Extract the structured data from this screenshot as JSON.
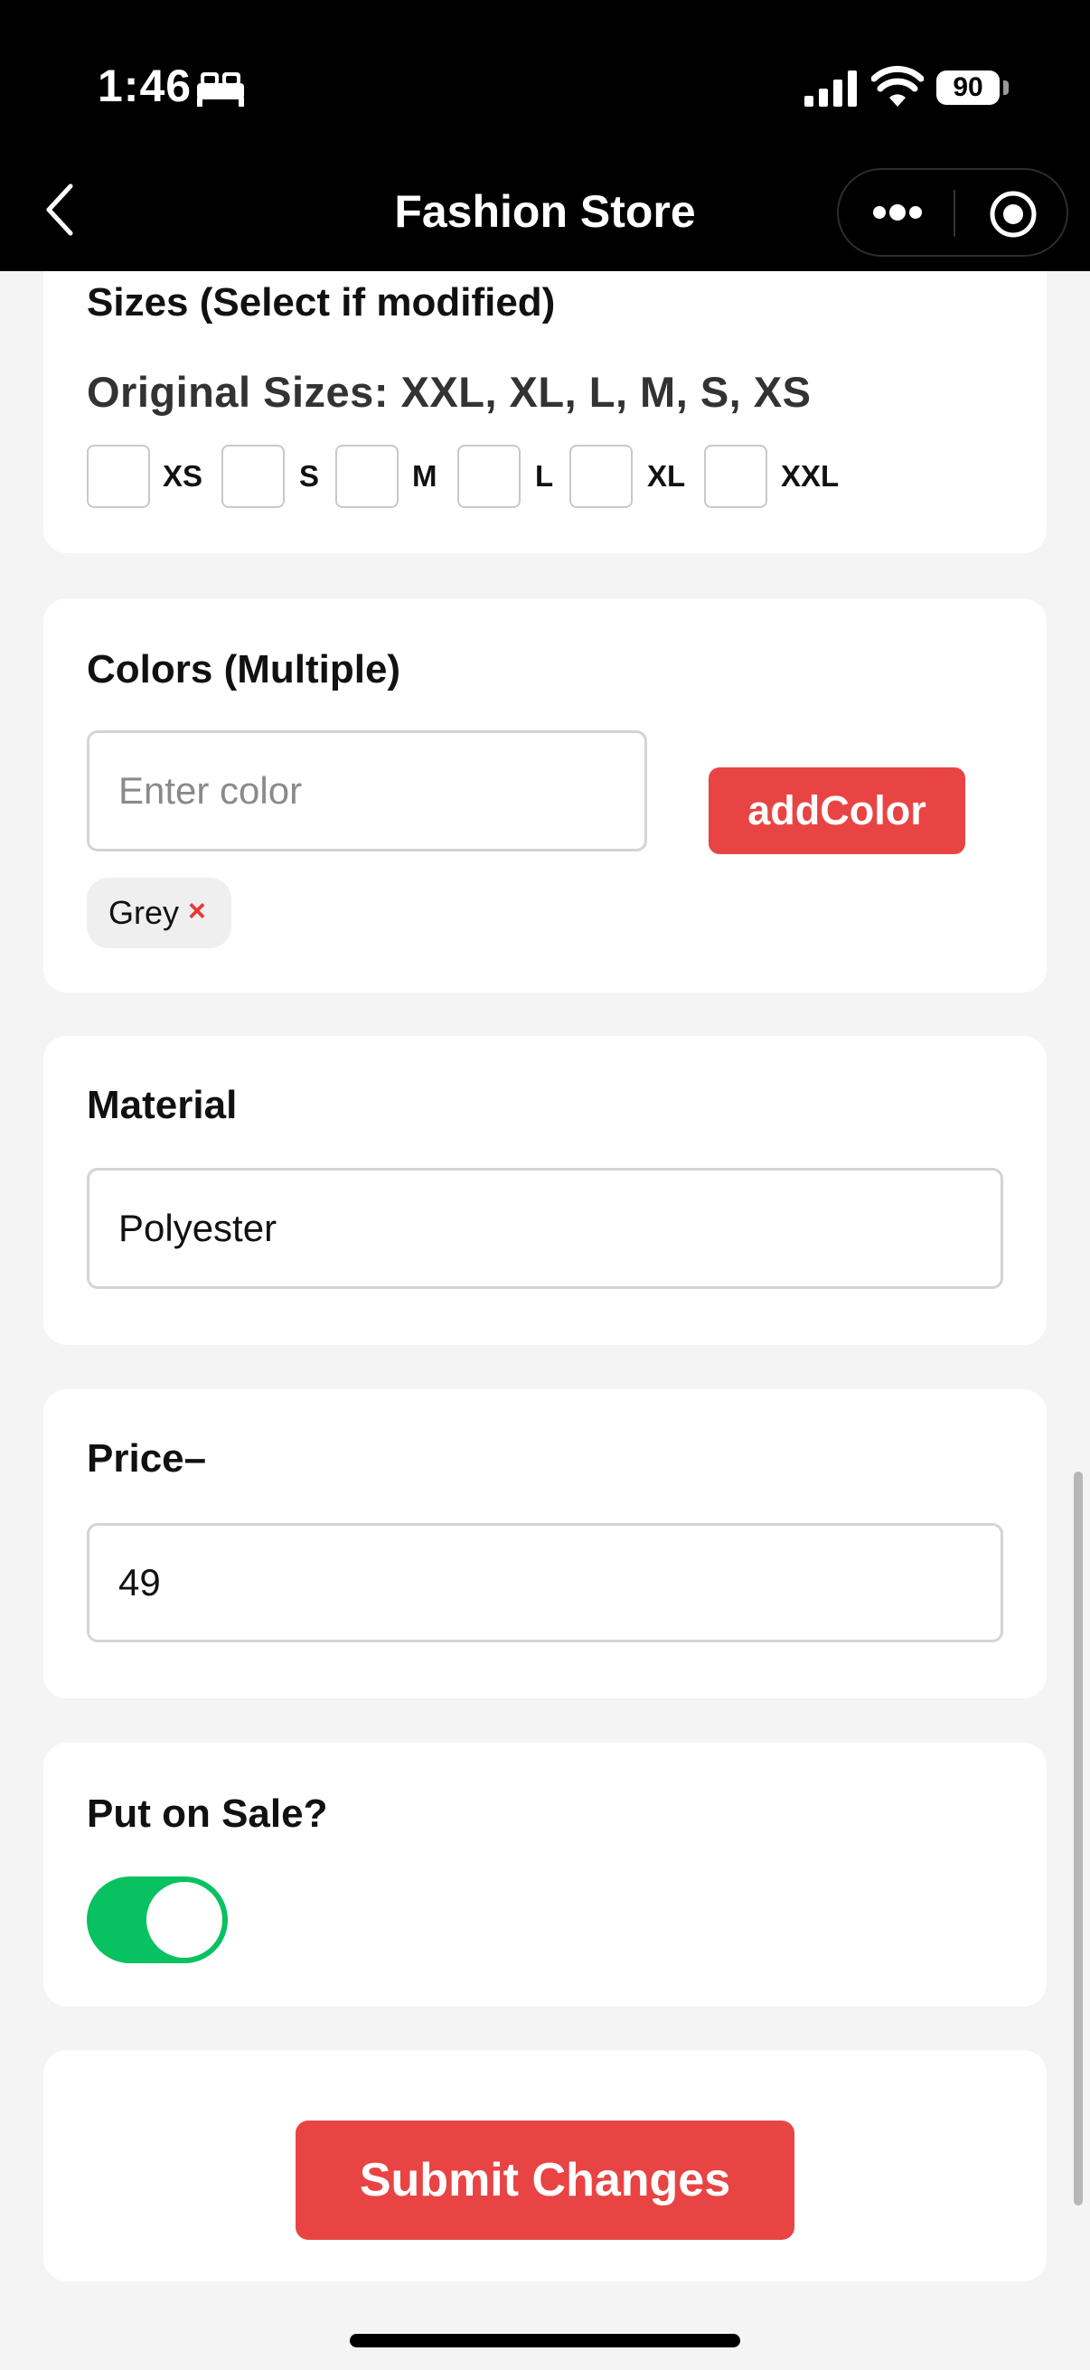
{
  "status_bar": {
    "time": "1:46",
    "battery": "90",
    "icons": [
      "bed-icon",
      "cellular-signal-icon",
      "wifi-icon",
      "battery-icon"
    ]
  },
  "nav": {
    "title": "Fashion Store",
    "icons": [
      "back-chevron-icon",
      "more-dots-icon",
      "target-circle-icon"
    ]
  },
  "sizes": {
    "label": "Sizes (Select if modified)",
    "original": "Original Sizes: XXL, XL, L, M, S, XS",
    "options": [
      "XS",
      "S",
      "M",
      "L",
      "XL",
      "XXL"
    ]
  },
  "colors": {
    "label": "Colors (Multiple)",
    "placeholder": "Enter color",
    "add_button": "addColor",
    "chips": [
      {
        "label": "Grey",
        "remove": "×"
      }
    ]
  },
  "material": {
    "label": "Material",
    "value": "Polyester"
  },
  "price": {
    "label": "Price–",
    "value": "49"
  },
  "sale": {
    "label": "Put on Sale?",
    "enabled": true
  },
  "submit": {
    "label": "Submit Changes"
  },
  "colors_palette": {
    "accent_red": "#e84444",
    "toggle_green": "#08c161",
    "page_background": "#f4f4f4"
  }
}
